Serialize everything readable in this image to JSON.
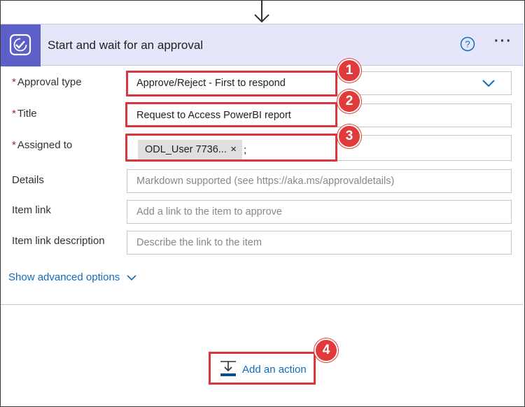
{
  "card": {
    "title": "Start and wait for an approval",
    "icon": "approvals-icon",
    "help_icon": "help-circle-icon",
    "more_icon": "ellipsis-icon",
    "more_label": "···"
  },
  "fields": {
    "approval_type": {
      "label": "Approval type",
      "required": "*",
      "value": "Approve/Reject - First to respond"
    },
    "title": {
      "label": "Title",
      "required": "*",
      "value": "Request to Access PowerBI report"
    },
    "assigned_to": {
      "label": "Assigned to",
      "required": "*",
      "tag": "ODL_User 7736...",
      "tag_remove": "×",
      "separator": ";"
    },
    "details": {
      "label": "Details",
      "placeholder": "Markdown supported (see https://aka.ms/approvaldetails)"
    },
    "item_link": {
      "label": "Item link",
      "placeholder": "Add a link to the item to approve"
    },
    "item_link_description": {
      "label": "Item link description",
      "placeholder": "Describe the link to the item"
    }
  },
  "advanced": {
    "label": "Show advanced options"
  },
  "add_action": {
    "label": "Add an action"
  },
  "callouts": [
    "1",
    "2",
    "3",
    "4"
  ],
  "colors": {
    "header_bg": "#e6e6fa",
    "app_icon_bg": "#5b5fc7",
    "link": "#0f6cbd",
    "highlight": "#d9363e",
    "required": "#a4262c"
  }
}
